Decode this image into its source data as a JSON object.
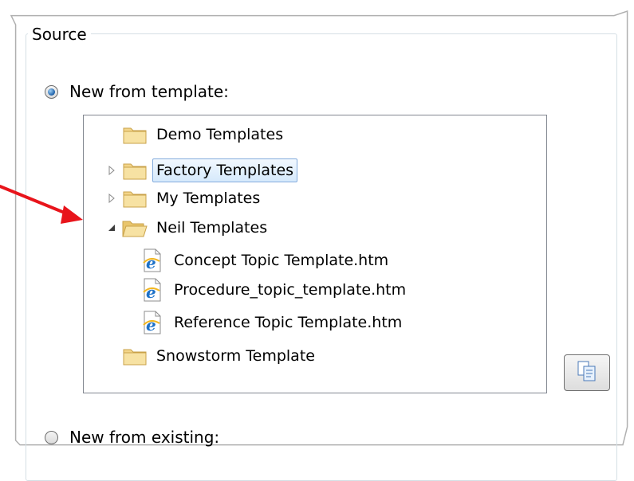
{
  "source_group": {
    "title": "Source",
    "new_from_template": {
      "label": "New from template:",
      "checked": true
    },
    "new_from_existing": {
      "label": "New from existing:",
      "checked": false
    }
  },
  "template_tree": {
    "items": [
      {
        "label": "Demo Templates",
        "icon": "folder-icon",
        "expander": "none"
      },
      {
        "label": "Factory Templates",
        "icon": "folder-icon",
        "expander": "collapsed",
        "selected": true
      },
      {
        "label": "My Templates",
        "icon": "folder-icon",
        "expander": "collapsed"
      },
      {
        "label": "Neil Templates",
        "icon": "folder-open-icon",
        "expander": "expanded"
      },
      {
        "label": "Concept Topic Template.htm",
        "icon": "ie-file-icon"
      },
      {
        "label": "Procedure_topic_template.htm",
        "icon": "ie-file-icon"
      },
      {
        "label": "Reference Topic Template.htm",
        "icon": "ie-file-icon"
      },
      {
        "label": "Snowstorm Template",
        "icon": "folder-icon",
        "expander": "none"
      }
    ]
  },
  "side_button": {
    "icon": "copy-icon"
  },
  "colors": {
    "annotation_arrow": "#e8141b",
    "selection_border": "#84acdd",
    "folder_fill": "#f3d58a"
  }
}
